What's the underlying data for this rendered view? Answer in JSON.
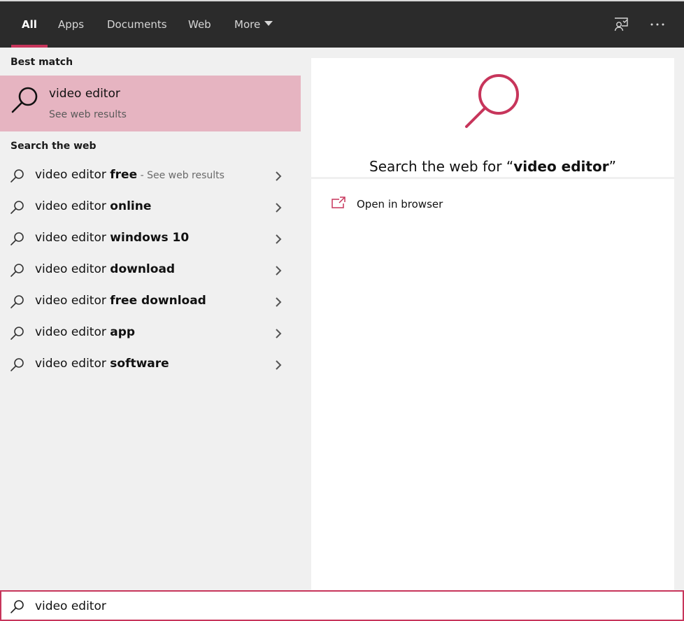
{
  "tabs": [
    {
      "label": "All",
      "active": true
    },
    {
      "label": "Apps"
    },
    {
      "label": "Documents"
    },
    {
      "label": "Web"
    },
    {
      "label": "More"
    }
  ],
  "topbar_icons": [
    "feedback-icon",
    "more-options-icon"
  ],
  "colors": {
    "accent": "#c7355b",
    "highlight": "#e6b4c1",
    "topbar": "#2b2b2b"
  },
  "best_match": {
    "section_title": "Best match",
    "title": "video editor",
    "subtitle": "See web results"
  },
  "search_web": {
    "section_title": "Search the web",
    "suggestions": [
      {
        "prefix": "video editor ",
        "bold": "free",
        "extra": " - See web results"
      },
      {
        "prefix": "video editor ",
        "bold": "online",
        "extra": ""
      },
      {
        "prefix": "video editor ",
        "bold": "windows 10",
        "extra": ""
      },
      {
        "prefix": "video editor ",
        "bold": "download",
        "extra": ""
      },
      {
        "prefix": "video editor ",
        "bold": "free download",
        "extra": ""
      },
      {
        "prefix": "video editor ",
        "bold": "app",
        "extra": ""
      },
      {
        "prefix": "video editor ",
        "bold": "software",
        "extra": ""
      }
    ]
  },
  "preview": {
    "title_prefix": "Search the web for “",
    "title_query": "video editor",
    "title_suffix": "”",
    "action_label": "Open in browser"
  },
  "search_box": {
    "value": "video editor"
  }
}
